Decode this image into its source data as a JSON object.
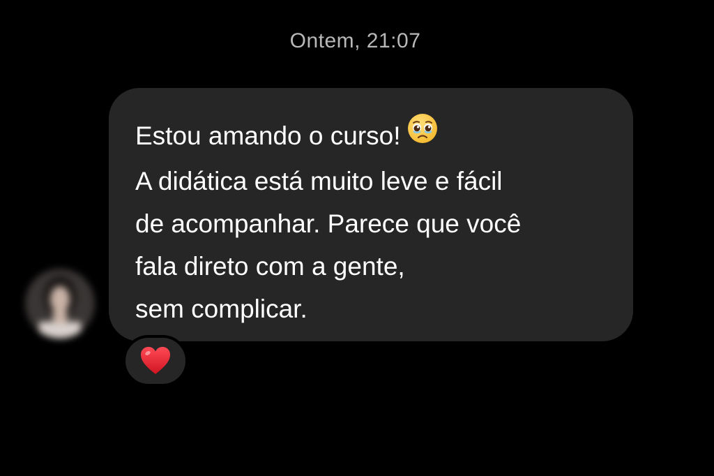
{
  "chat": {
    "timestamp": "Ontem, 21:07",
    "message": {
      "lines": [
        "Estou amando o curso!",
        "A didática está muito leve e fácil",
        "de acompanhar. Parece que você",
        "fala direto com a gente,",
        "sem complicar."
      ],
      "inline_emoji": "face-holding-back-tears-icon"
    },
    "reaction": {
      "emoji": "red-heart-icon"
    },
    "sender": {
      "avatar": "blurred-profile-photo"
    }
  },
  "colors": {
    "background": "#000000",
    "bubble": "#262626",
    "timestamp_text": "#b8b8b8",
    "message_text": "#ffffff",
    "heart": "#e0202c"
  }
}
